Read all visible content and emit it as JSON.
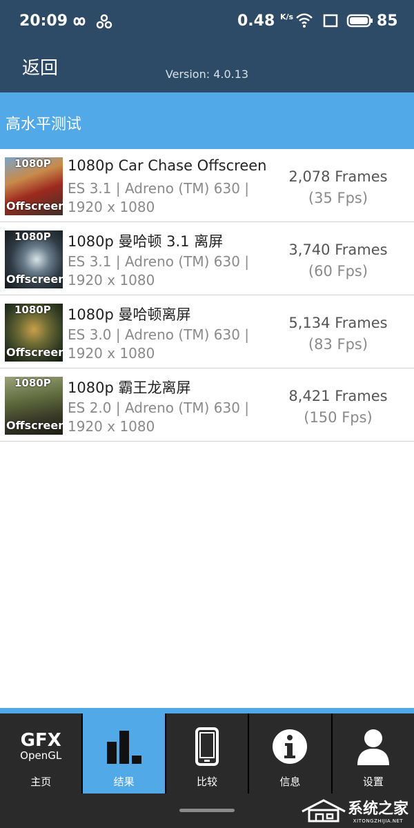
{
  "status_bar": {
    "time": "20:09",
    "speed": "0.48",
    "speed_unit": "K/s",
    "battery": "85"
  },
  "header": {
    "back_label": "返回",
    "version": "Version: 4.0.13"
  },
  "section": {
    "title": "高水平测试"
  },
  "results": [
    {
      "thumb_res": "1080P",
      "thumb_tag": "Offscreen",
      "title": "1080p Car Chase Offscreen",
      "api": "ES 3.1 | Adreno (TM) 630 |",
      "resolution": "1920 x 1080",
      "frames": "2,078 Frames",
      "fps": "(35 Fps)"
    },
    {
      "thumb_res": "1080P",
      "thumb_tag": "Offscreen",
      "title": "1080p 曼哈顿 3.1 离屏",
      "api": "ES 3.1 | Adreno (TM) 630 |",
      "resolution": "1920 x 1080",
      "frames": "3,740 Frames",
      "fps": "(60 Fps)"
    },
    {
      "thumb_res": "1080P",
      "thumb_tag": "Offscreen",
      "title": "1080p 曼哈顿离屏",
      "api": "ES 3.0 | Adreno (TM) 630 |",
      "resolution": "1920 x 1080",
      "frames": "5,134 Frames",
      "fps": "(83 Fps)"
    },
    {
      "thumb_res": "1080P",
      "thumb_tag": "Offscreen",
      "title": "1080p 霸王龙离屏",
      "api": "ES 2.0 | Adreno (TM) 630 |",
      "resolution": "1920 x 1080",
      "frames": "8,421 Frames",
      "fps": "(150 Fps)"
    }
  ],
  "tabs": {
    "home_logo_top": "GFX",
    "home_logo_bottom": "OpenGL",
    "home": "主页",
    "results": "结果",
    "compare": "比较",
    "info": "信息",
    "settings": "设置",
    "active": "results"
  },
  "watermark": {
    "text": "系统之家",
    "subtext": "XITONGZHIJIA.NET"
  },
  "colors": {
    "header_bg": "#2d4a66",
    "accent": "#51a9e8",
    "tab_bg": "#2a2a2a"
  }
}
